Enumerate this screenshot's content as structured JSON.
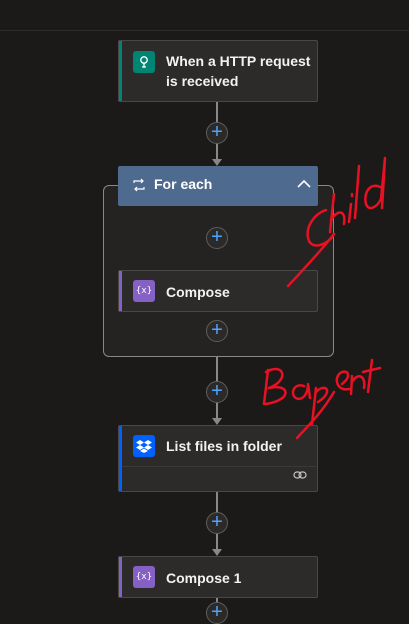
{
  "trigger": {
    "title": "When a HTTP request is received",
    "title_line1": "When a HTTP request",
    "title_line2": "is received",
    "accent": "#008575"
  },
  "foreach": {
    "title": "For each",
    "color": "#4f6a8f"
  },
  "compose_inner": {
    "title": "Compose",
    "accent": "#8661c5"
  },
  "list_files": {
    "title": "List files in folder",
    "accent": "#0061fe"
  },
  "compose_1": {
    "title": "Compose 1",
    "accent": "#8661c5"
  },
  "annotations": {
    "child": "Child",
    "parent": "Parent",
    "ink_color": "#e81123"
  }
}
